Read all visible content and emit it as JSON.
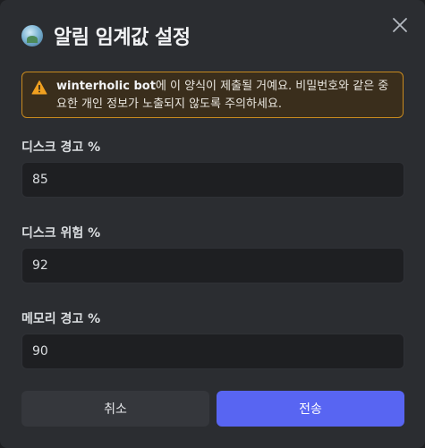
{
  "modal": {
    "title": "알림 임계값 설정",
    "close_icon": "close-icon",
    "app_icon": "app-avatar-icon"
  },
  "warning": {
    "icon": "warning-triangle-icon",
    "bot_name": "winterholic bot",
    "message": "에 이 양식이 제출될 거예요. 비밀번호와 같은 중요한 개인 정보가 노출되지 않도록 주의하세요.",
    "border_color": "#c88a1e",
    "icon_color": "#f0a020"
  },
  "fields": [
    {
      "label": "디스크 경고 %",
      "value": "85"
    },
    {
      "label": "디스크 위험 %",
      "value": "92"
    },
    {
      "label": "메모리 경고 %",
      "value": "90"
    }
  ],
  "buttons": {
    "cancel_label": "취소",
    "submit_label": "전송",
    "submit_color": "#5865f2"
  }
}
